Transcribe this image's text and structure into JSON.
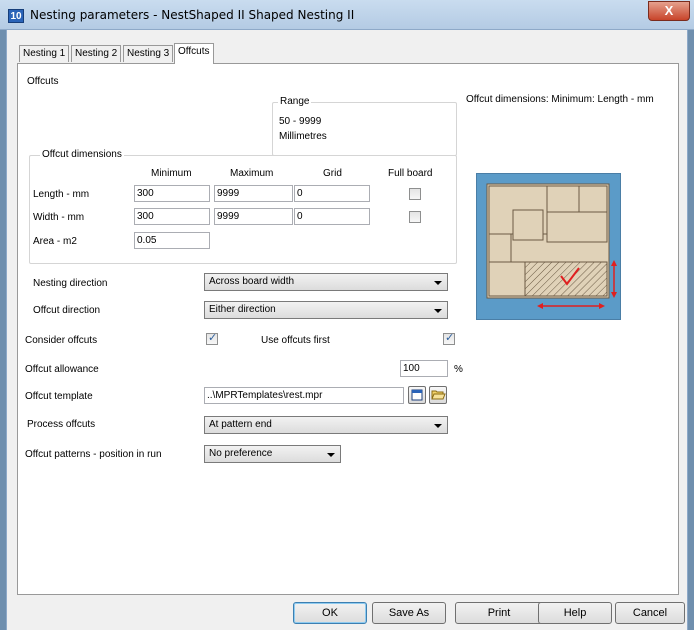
{
  "window": {
    "title": "Nesting parameters - NestShaped II Shaped Nesting II",
    "icon_text": "10",
    "close_label": "X"
  },
  "tabs": [
    {
      "label": "Nesting 1"
    },
    {
      "label": "Nesting 2"
    },
    {
      "label": "Nesting 3"
    },
    {
      "label": "Offcuts",
      "active": true
    }
  ],
  "panel": {
    "heading": "Offcuts",
    "range": {
      "legend": "Range",
      "values": "50 - 9999",
      "units": "Millimetres"
    },
    "info_text": "Offcut dimensions: Minimum: Length - mm",
    "dimensions": {
      "legend": "Offcut dimensions",
      "headers": {
        "minimum": "Minimum",
        "maximum": "Maximum",
        "grid": "Grid",
        "full_board": "Full board"
      },
      "length": {
        "label": "Length - mm",
        "minimum": "300",
        "maximum": "9999",
        "grid": "0",
        "full_board": false
      },
      "width": {
        "label": "Width - mm",
        "minimum": "300",
        "maximum": "9999",
        "grid": "0",
        "full_board": false
      },
      "area": {
        "label": "Area - m2",
        "value": "0.05"
      }
    },
    "nesting_direction": {
      "label": "Nesting direction",
      "value": "Across board width"
    },
    "offcut_direction": {
      "label": "Offcut direction",
      "value": "Either direction"
    },
    "consider_offcuts": {
      "label": "Consider offcuts",
      "checked": true
    },
    "use_offcuts_first": {
      "label": "Use offcuts first",
      "checked": true
    },
    "offcut_allowance": {
      "label": "Offcut allowance",
      "value": "100",
      "unit": "%"
    },
    "offcut_template": {
      "label": "Offcut template",
      "value": "..\\MPRTemplates\\rest.mpr",
      "browse_icon": "list-icon",
      "folder_icon": "folder-open-icon"
    },
    "process_offcuts": {
      "label": "Process offcuts",
      "value": "At pattern end"
    },
    "offcut_patterns": {
      "label": "Offcut patterns - position in run",
      "value": "No preference"
    }
  },
  "buttons": {
    "ok": "OK",
    "save_as": "Save As",
    "print": "Print",
    "help": "Help",
    "cancel": "Cancel"
  },
  "colors": {
    "preview_bg": "#5b9bc8",
    "board": "#e0d2b8",
    "arrow": "#e02020"
  }
}
